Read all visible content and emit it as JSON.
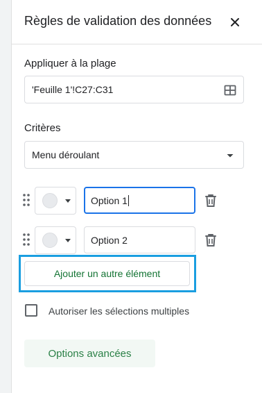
{
  "header": {
    "title": "Règles de validation des données",
    "close_icon": "close-icon"
  },
  "range": {
    "label": "Appliquer à la plage",
    "value": "'Feuille 1'!C27:C31",
    "icon": "grid-select-icon"
  },
  "criteria": {
    "label": "Critères",
    "selected": "Menu déroulant",
    "icon": "dropdown-arrow-icon"
  },
  "options": [
    {
      "value": "Option 1",
      "focused": true
    },
    {
      "value": "Option 2",
      "focused": false
    }
  ],
  "add_item_label": "Ajouter un autre élément",
  "multi_select": {
    "label": "Autoriser les sélections multiples",
    "checked": false
  },
  "advanced_options_label": "Options avancées",
  "colors": {
    "accent_green": "#137333",
    "focus_blue": "#1a73e8",
    "highlight_blue": "#1a9ee0",
    "swatch_gray": "#e8eaed"
  }
}
